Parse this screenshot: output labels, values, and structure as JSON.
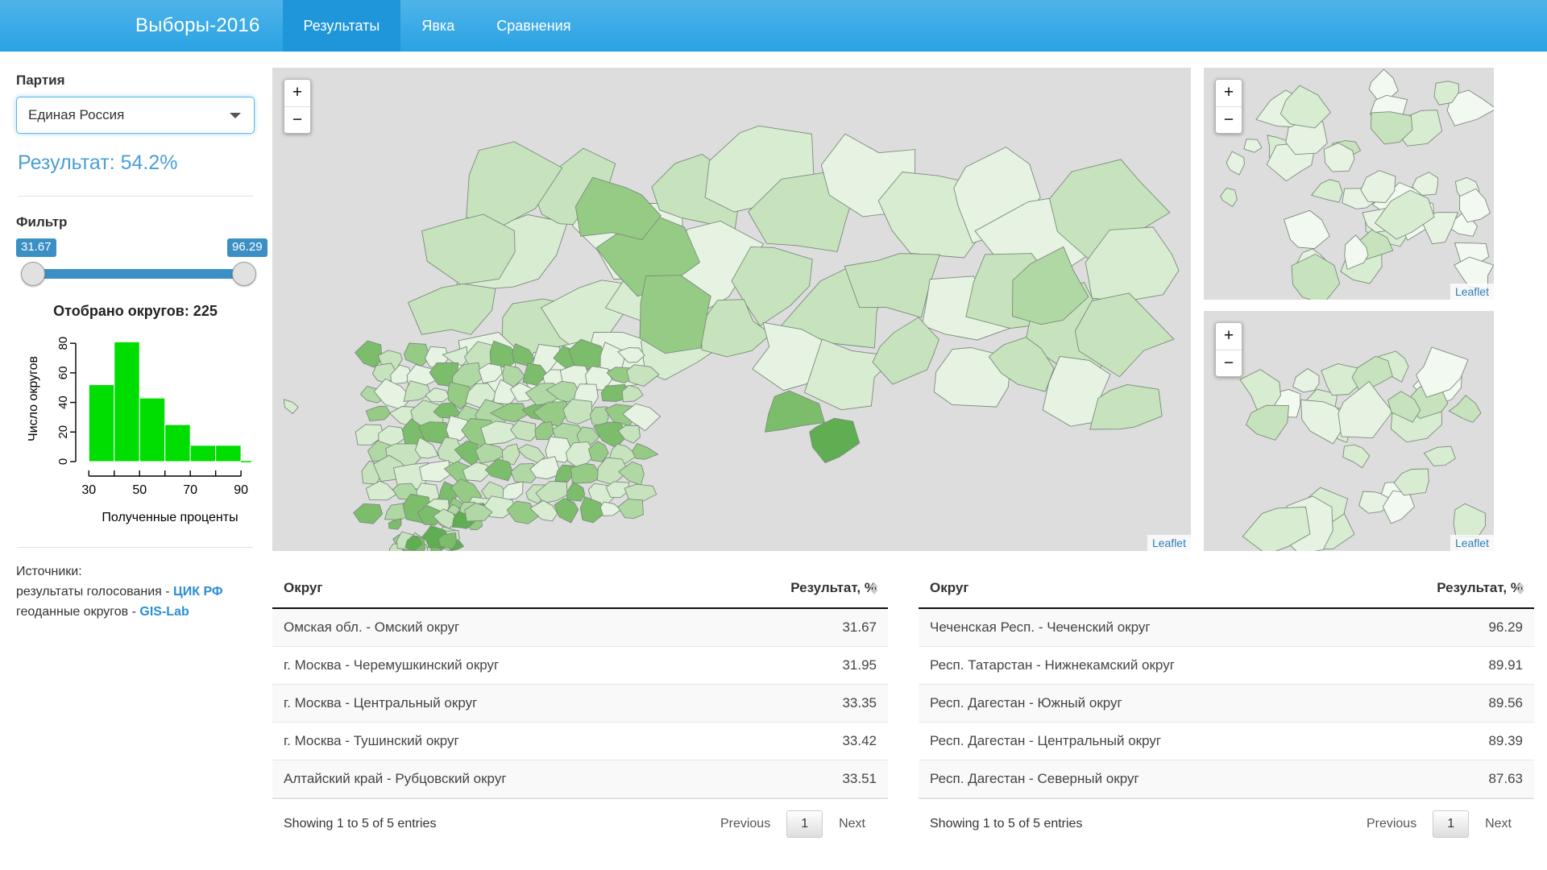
{
  "navbar": {
    "brand": "Выборы-2016",
    "items": [
      {
        "label": "Результаты",
        "active": true
      },
      {
        "label": "Явка",
        "active": false
      },
      {
        "label": "Сравнения",
        "active": false
      }
    ]
  },
  "sidebar": {
    "party_label": "Партия",
    "party_selected": "Единая Россия",
    "result_line": "Результат: 54.2%",
    "filter_label": "Фильтр",
    "slider": {
      "min_value": "31.67",
      "max_value": "96.29"
    },
    "hist_title": "Отобрано округов: 225",
    "sources": {
      "heading": "Источники:",
      "line1_prefix": "результаты голосования - ",
      "line1_link": "ЦИК РФ",
      "line2_prefix": "геоданные округов - ",
      "line2_link": "GIS-Lab"
    }
  },
  "chart_data": {
    "type": "bar",
    "title": "Отобрано округов: 225",
    "xlabel": "Полученные проценты",
    "ylabel": "Число округов",
    "categories": [
      "30-40",
      "40-50",
      "50-60",
      "60-70",
      "70-80",
      "80-90"
    ],
    "bin_edges": [
      30,
      40,
      50,
      60,
      70,
      80,
      90
    ],
    "values": [
      52,
      81,
      43,
      25,
      11,
      11
    ],
    "xlim": [
      28,
      96
    ],
    "ylim": [
      0,
      85
    ],
    "xticks": [
      30,
      40,
      50,
      60,
      70,
      80,
      90
    ],
    "xtick_labels": [
      "30",
      "",
      "50",
      "",
      "70",
      "",
      "90"
    ],
    "yticks": [
      0,
      20,
      40,
      60,
      80
    ],
    "ytick_labels": [
      "0",
      "20",
      "40",
      "60",
      "80"
    ],
    "bar_color": "#00dd00",
    "grid": false,
    "legend": null
  },
  "maps": {
    "main": {
      "zoom_in": "+",
      "zoom_out": "−",
      "credit": "Leaflet"
    },
    "kaliningrad": {
      "zoom_in": "+",
      "zoom_out": "−",
      "credit": "Leaflet"
    },
    "fareast": {
      "zoom_in": "+",
      "zoom_out": "−",
      "credit": "Leaflet"
    }
  },
  "tables": {
    "left": {
      "columns": [
        "Округ",
        "Результат, %"
      ],
      "rows": [
        {
          "name": "Омская обл. - Омский округ",
          "value": "31.67"
        },
        {
          "name": "г. Москва - Черемушкинский округ",
          "value": "31.95"
        },
        {
          "name": "г. Москва - Центральный округ",
          "value": "33.35"
        },
        {
          "name": "г. Москва - Тушинский округ",
          "value": "33.42"
        },
        {
          "name": "Алтайский край - Рубцовский округ",
          "value": "33.51"
        }
      ],
      "info": "Showing 1 to 5 of 5 entries",
      "prev": "Previous",
      "page": "1",
      "next": "Next"
    },
    "right": {
      "columns": [
        "Округ",
        "Результат, %"
      ],
      "rows": [
        {
          "name": "Чеченская Респ. - Чеченский округ",
          "value": "96.29"
        },
        {
          "name": "Респ. Татарстан - Нижнекамский округ",
          "value": "89.91"
        },
        {
          "name": "Респ. Дагестан - Южный округ",
          "value": "89.56"
        },
        {
          "name": "Респ. Дагестан - Центральный округ",
          "value": "89.39"
        },
        {
          "name": "Респ. Дагестан - Северный округ",
          "value": "87.63"
        }
      ],
      "info": "Showing 1 to 5 of 5 entries",
      "prev": "Previous",
      "page": "1",
      "next": "Next"
    }
  },
  "colors": {
    "brand_blue": "#2aa3e4",
    "accent_blue": "#4b9fd5",
    "bar_green": "#00dd00",
    "map_bg": "#dddddd"
  }
}
